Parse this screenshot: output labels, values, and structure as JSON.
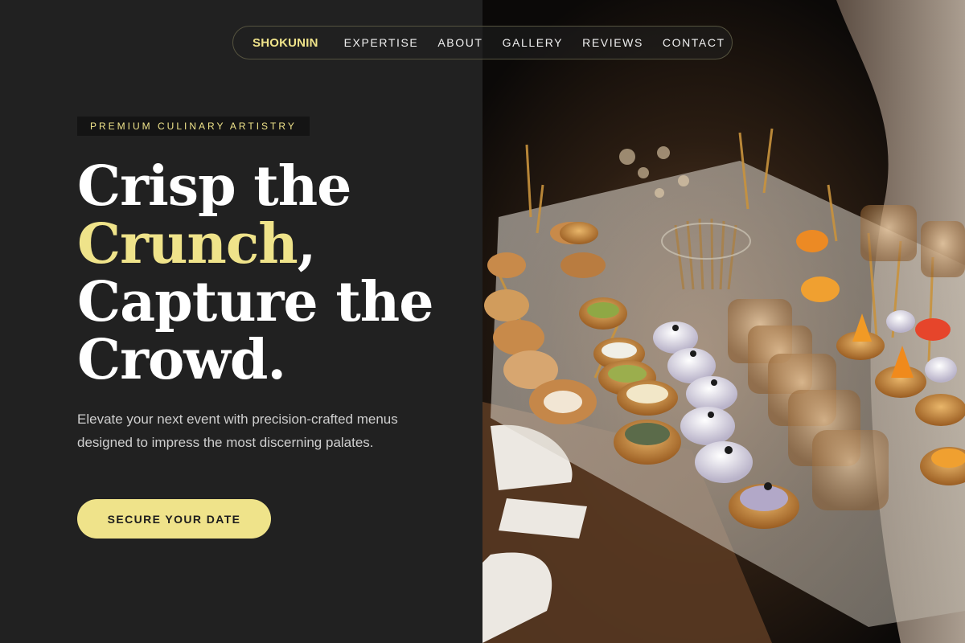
{
  "nav": {
    "brand": "SHOKUNIN",
    "links": [
      "EXPERTISE",
      "ABOUT",
      "GALLERY",
      "REVIEWS",
      "CONTACT"
    ]
  },
  "hero": {
    "badge": "PREMIUM CULINARY ARTISTRY",
    "headline_line1": "Crisp the",
    "headline_accent": "Crunch",
    "headline_comma": ",",
    "headline_line3": "Capture the",
    "headline_line4": "Crowd.",
    "subtext": "Elevate your next event with precision-crafted menus designed to impress the most discerning palates.",
    "cta_label": "SECURE YOUR DATE"
  },
  "image": {
    "subject": "catering-canapes-platter-photo"
  },
  "colors": {
    "background": "#212121",
    "accent": "#efe38a",
    "text": "#ffffff"
  }
}
